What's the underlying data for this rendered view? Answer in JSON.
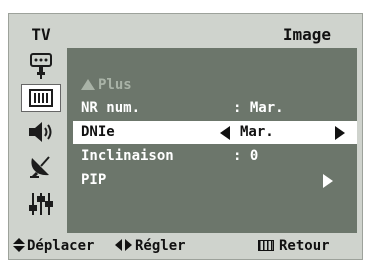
{
  "header": {
    "tab_label": "TV",
    "title": "Image"
  },
  "sidebar": {
    "items": [
      {
        "icon": "input-icon",
        "selected": false
      },
      {
        "icon": "picture-icon",
        "selected": true
      },
      {
        "icon": "sound-icon",
        "selected": false
      },
      {
        "icon": "channel-icon",
        "selected": false
      },
      {
        "icon": "setup-icon",
        "selected": false
      }
    ]
  },
  "menu": {
    "more_label": "Plus",
    "items": [
      {
        "label": "NR num.",
        "separator": ":",
        "value": "Mar."
      },
      {
        "label": "DNIe",
        "value": "Mar."
      },
      {
        "label": "Inclinaison",
        "separator": ":",
        "value": "0"
      },
      {
        "label": "PIP"
      }
    ]
  },
  "footer": {
    "move_label": "Déplacer",
    "adjust_label": "Régler",
    "return_label": "Retour"
  },
  "colors": {
    "frame": "#cfd3cd",
    "panel": "#6c766b",
    "highlight": "#ffffff",
    "disabled_text": "#a9b3a7"
  }
}
